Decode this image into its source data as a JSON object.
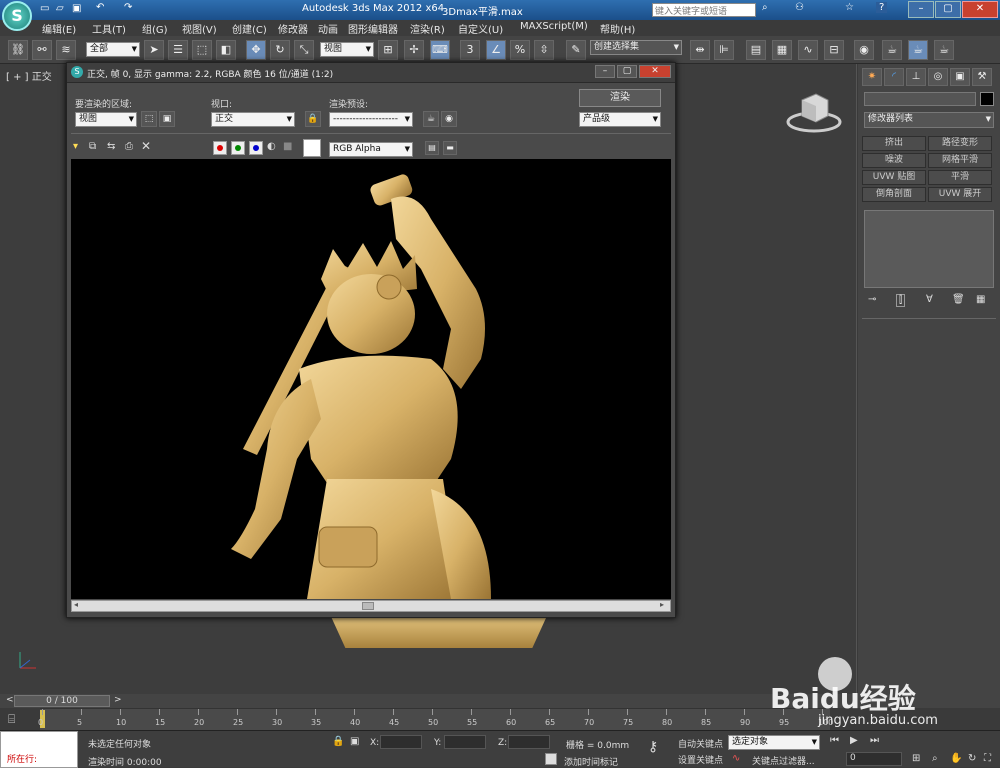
{
  "title": {
    "app": "Autodesk 3ds Max  2012 x64",
    "file": "3Dmax平滑.max",
    "search_placeholder": "键入关键字或短语"
  },
  "menu": [
    "编辑(E)",
    "工具(T)",
    "组(G)",
    "视图(V)",
    "创建(C)",
    "修改器",
    "动画",
    "图形编辑器",
    "渲染(R)",
    "自定义(U)",
    "MAXScript(M)",
    "帮助(H)"
  ],
  "toolbar": {
    "filter_value": "全部",
    "view_value": "视图",
    "named_selection": "创建选择集",
    "snap_number": "3"
  },
  "viewport": {
    "label": "[ + ] 正交"
  },
  "render_window": {
    "title": "正交, 帧 0, 显示 gamma: 2.2, RGBA 颜色 16 位/通道 (1:2)",
    "area_label": "要渲染的区域:",
    "area_value": "视图",
    "viewport_label": "视口:",
    "viewport_value": "正交",
    "preset_label": "渲染预设:",
    "preset_value": "--------------------",
    "render_button": "渲染",
    "quality_value": "产品级",
    "channel_value": "RGB Alpha"
  },
  "command_panel": {
    "modifier_list": "修改器列表",
    "buttons": [
      "挤出",
      "路径变形",
      "噪波",
      "网格平滑",
      "UVW 贴图",
      "平滑",
      "倒角剖面",
      "UVW 展开"
    ]
  },
  "timeline": {
    "frame": "0 / 100",
    "ticks": [
      "0",
      "5",
      "10",
      "15",
      "20",
      "25",
      "30",
      "35",
      "40",
      "45",
      "50",
      "55",
      "60",
      "65",
      "70",
      "75",
      "80",
      "85",
      "90",
      "95",
      "100"
    ]
  },
  "status": {
    "running": "所在行:",
    "message": "未选定任何对象",
    "render_time": "渲染时间  0:00:00",
    "x_label": "X:",
    "y_label": "Y:",
    "z_label": "Z:",
    "grid": "栅格 = 0.0mm",
    "add_tag": "添加时间标记",
    "auto_key": "自动关键点",
    "set_key": "设置关键点",
    "selected": "选定对象",
    "key_filter": "关键点过滤器...",
    "frame_value": "0"
  },
  "watermark": {
    "brand": "Baidu经验",
    "url": "jingyan.baidu.com"
  }
}
